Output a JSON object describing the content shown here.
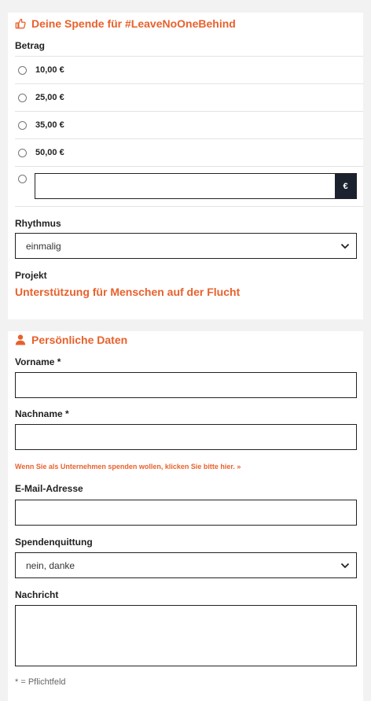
{
  "donation": {
    "title": "Deine Spende für #LeaveNoOneBehind",
    "title_icon": "thumbs-up-icon",
    "amount_label": "Betrag",
    "amounts": [
      "10,00 €",
      "25,00 €",
      "35,00 €",
      "50,00 €"
    ],
    "custom_amount_value": "",
    "currency": "€",
    "rhythm_label": "Rhythmus",
    "rhythm_value": "einmalig",
    "project_label": "Projekt",
    "project_name": "Unterstützung für Menschen auf der Flucht"
  },
  "personal": {
    "title": "Persönliche Daten",
    "title_icon": "person-icon",
    "firstname_label": "Vorname *",
    "firstname_value": "",
    "lastname_label": "Nachname *",
    "lastname_value": "",
    "company_hint": "Wenn Sie als Unternehmen spenden wollen, klicken Sie bitte hier. »",
    "email_label": "E-Mail-Adresse",
    "email_value": "",
    "receipt_label": "Spendenquittung",
    "receipt_value": "nein, danke",
    "message_label": "Nachricht",
    "message_value": "",
    "required_note": "* = Pflichtfeld"
  },
  "colors": {
    "accent": "#e8612c",
    "currency_bg": "#1c2130",
    "page_bg": "#f2f2f2"
  }
}
